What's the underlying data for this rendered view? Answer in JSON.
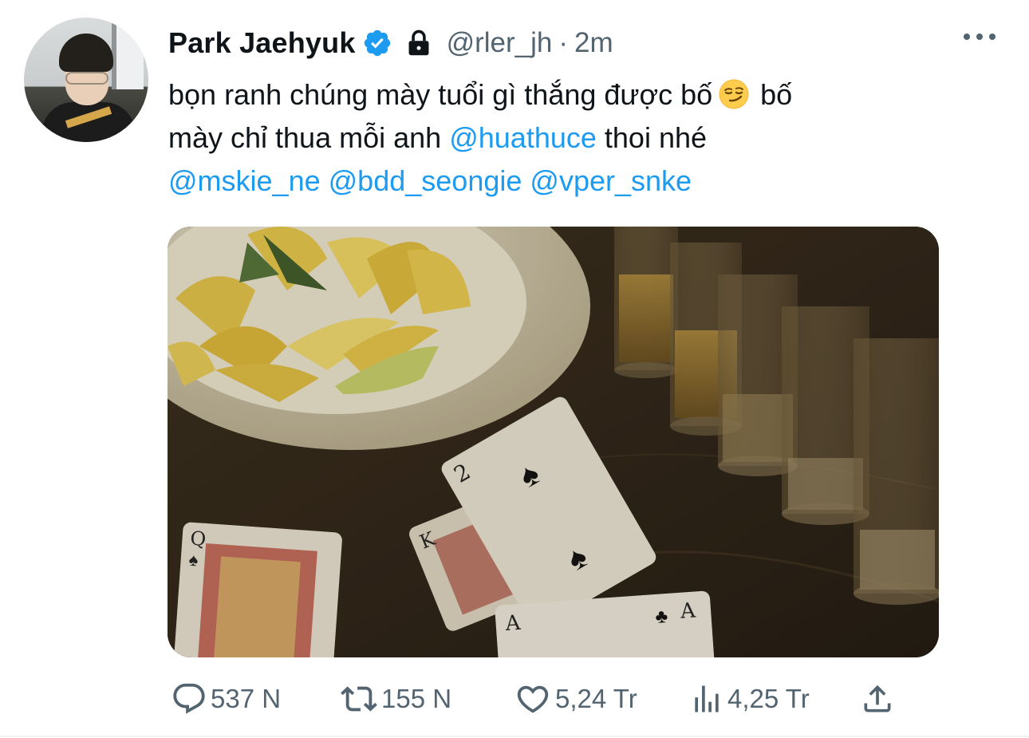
{
  "tweet": {
    "author_name": "Park Jaehyuk",
    "handle": "@rler_jh",
    "separator": "·",
    "time": "2m",
    "text_line1": "bọn ranh chúng mày tuổi gì thắng được bố",
    "text_line1_after": "bố",
    "text_line2_before": "mày chỉ thua mỗi anh",
    "mention_main": "@huathuce",
    "text_line2_after": "thoi nhé",
    "mentions": [
      "@mskie_ne",
      "@bdd_seongie",
      "@vper_snke"
    ],
    "emoji": "smirking-face",
    "verified": true,
    "protected": true
  },
  "actions": {
    "replies": "537 N",
    "retweets": "155 N",
    "likes": "5,24 Tr",
    "views": "4,25 Tr"
  },
  "icons": {
    "reply": "reply-icon",
    "retweet": "retweet-icon",
    "like": "heart-icon",
    "views": "views-icon",
    "share": "share-icon",
    "more": "more-icon",
    "verified": "verified-badge-icon",
    "lock": "lock-icon"
  },
  "colors": {
    "accent": "#1d9bf0",
    "text": "#0f1419",
    "muted": "#536471"
  }
}
